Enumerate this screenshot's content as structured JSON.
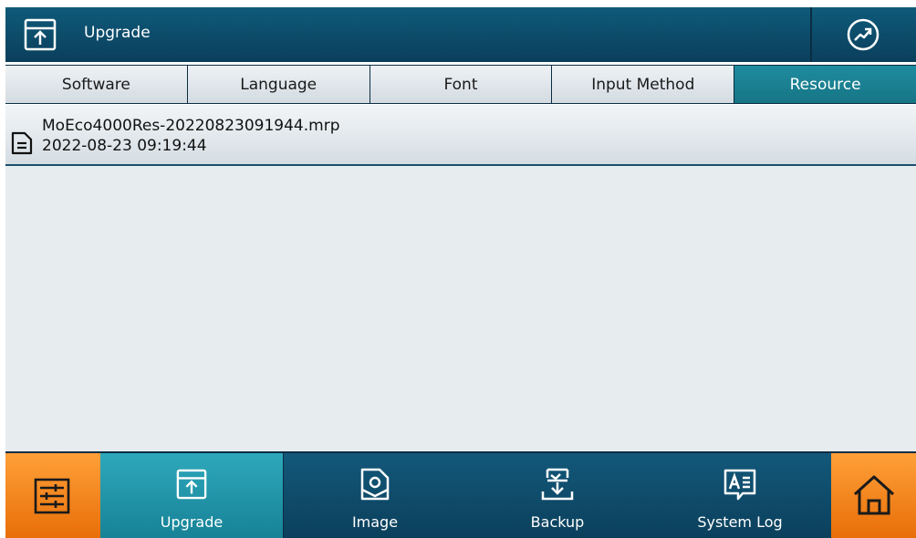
{
  "header": {
    "title": "Upgrade",
    "icon": "upgrade-icon",
    "right_icon": "trend-icon"
  },
  "tabs": [
    {
      "label": "Software",
      "active": false
    },
    {
      "label": "Language",
      "active": false
    },
    {
      "label": "Font",
      "active": false
    },
    {
      "label": "Input Method",
      "active": false
    },
    {
      "label": "Resource",
      "active": true
    }
  ],
  "files": [
    {
      "name": "MoEco4000Res-20220823091944.mrp",
      "date": "2022-08-23 09:19:44",
      "icon": "document-icon"
    }
  ],
  "bottom_nav": {
    "settings_icon": "settings-sliders-icon",
    "items": [
      {
        "label": "Upgrade",
        "icon": "upgrade-icon",
        "active": true
      },
      {
        "label": "Image",
        "icon": "image-icon",
        "active": false
      },
      {
        "label": "Backup",
        "icon": "backup-icon",
        "active": false
      },
      {
        "label": "System Log",
        "icon": "system-log-icon",
        "active": false
      }
    ],
    "home_icon": "home-icon"
  },
  "colors": {
    "header": "#0f5a7a",
    "active_tab": "#1f8ca0",
    "accent_orange": "#f4891f",
    "active_nav": "#2398ac"
  }
}
